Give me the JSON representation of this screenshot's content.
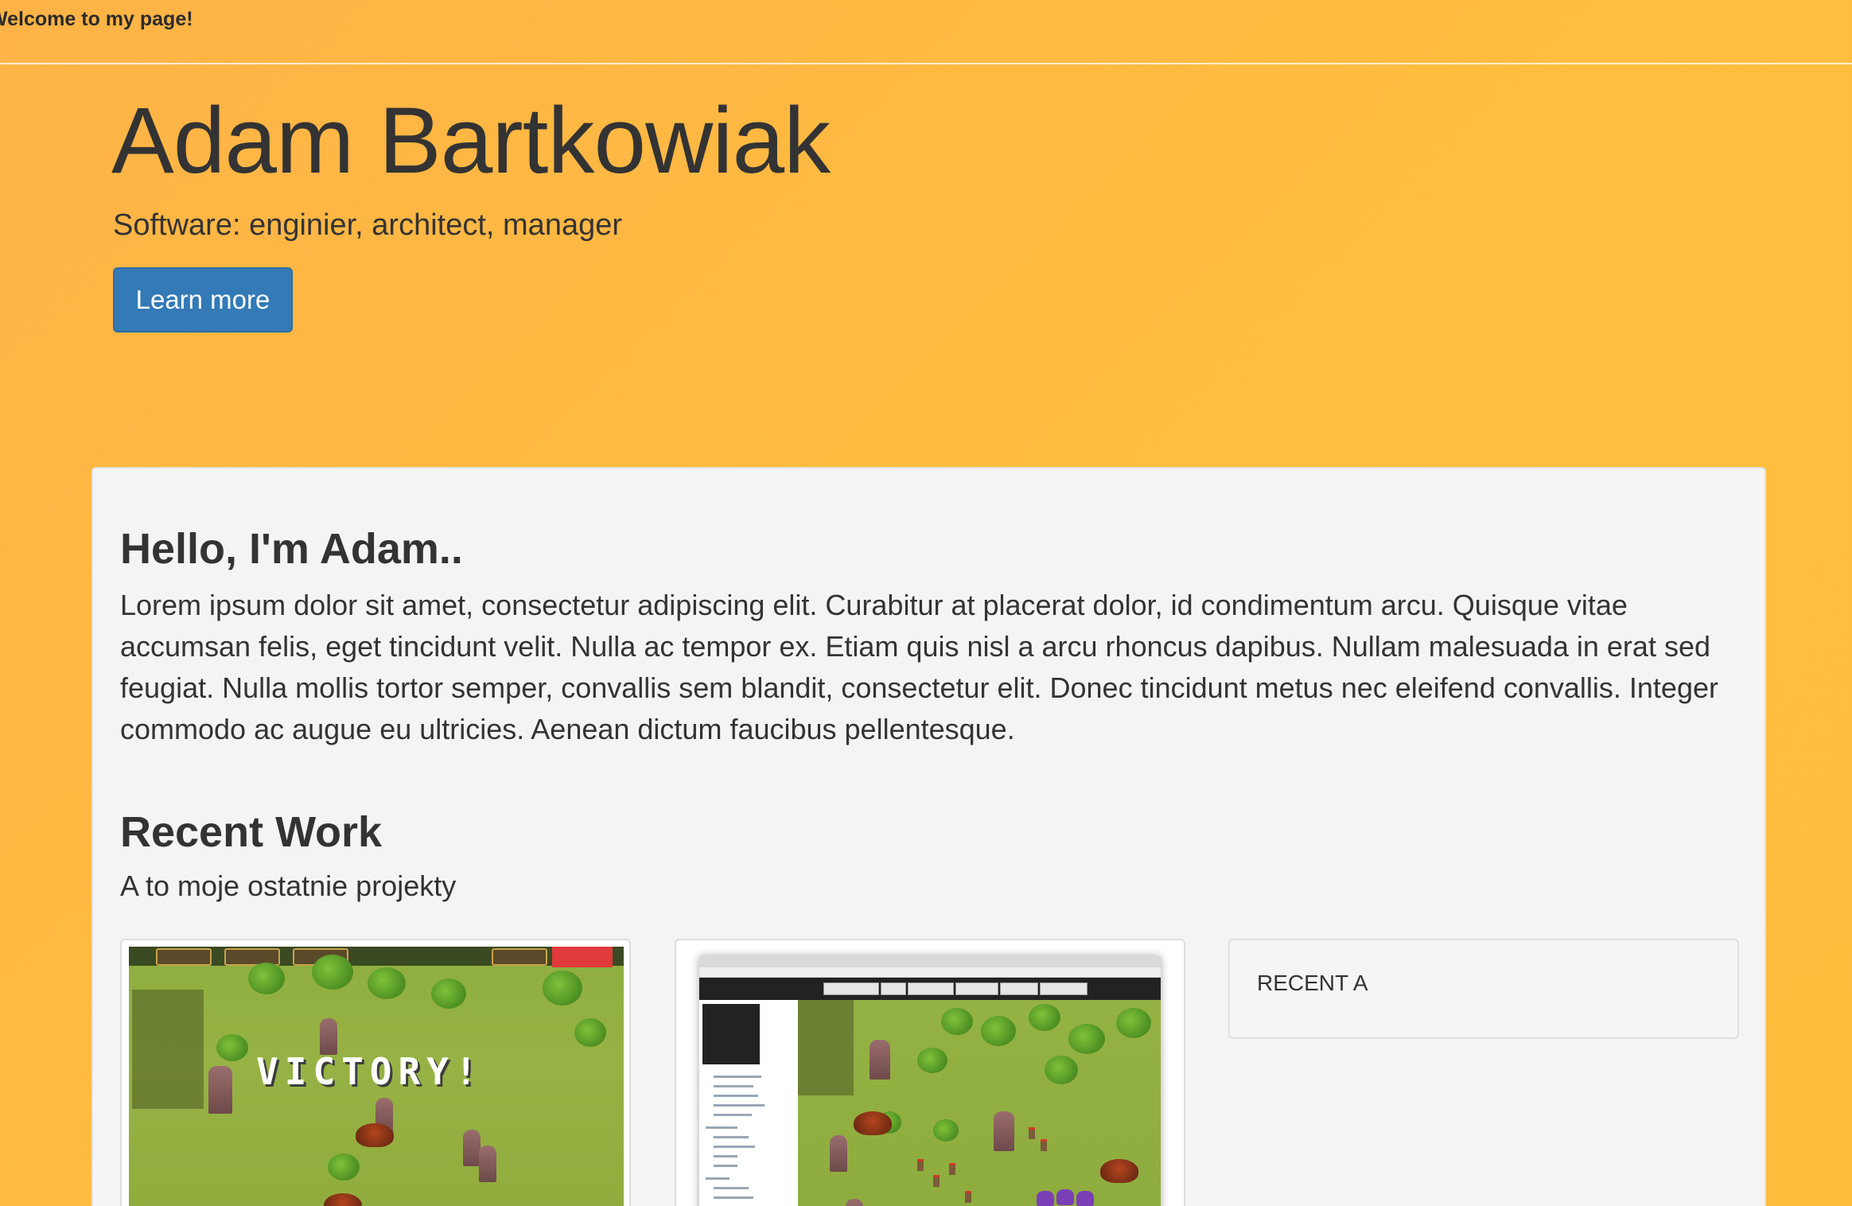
{
  "topbar": {
    "text": "Welcome to my page!"
  },
  "hero": {
    "title": "Adam Bartkowiak",
    "subtitle": "Software: enginier, architect, manager",
    "button_label": "Learn more",
    "button_color": "#337ab7"
  },
  "about": {
    "heading": "Hello, I'm Adam..",
    "text": "Lorem ipsum dolor sit amet, consectetur adipiscing elit. Curabitur at placerat dolor, id condimentum arcu. Quisque vitae accumsan felis, eget tincidunt velit. Nulla ac tempor ex. Etiam quis nisl a arcu rhoncus dapibus. Nullam malesuada in erat sed feugiat. Nulla mollis tortor semper, convallis sem blandit, consectetur elit. Donec tincidunt metus nec eleifend convallis. Integer commodo ac augue eu ultricies. Aenean dictum faucibus pellentesque."
  },
  "work": {
    "heading": "Recent Work",
    "subtitle": "A to moje ostatnie projekty",
    "cards": [
      {
        "image_text": "VICTORY!"
      },
      {},
      {
        "title": "RECENT A"
      }
    ]
  },
  "colors": {
    "background": "#ffb944",
    "panel": "#f4f4f4",
    "text": "#333333"
  }
}
